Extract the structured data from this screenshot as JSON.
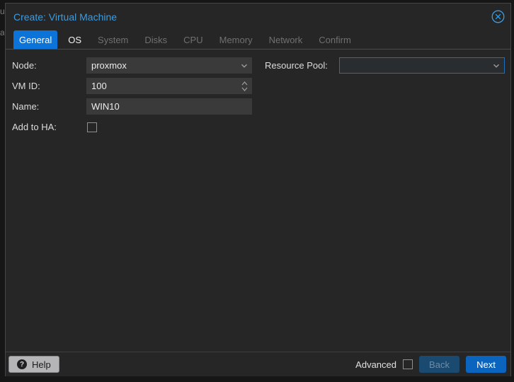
{
  "background": {
    "fragments": [
      "u",
      "al"
    ]
  },
  "dialog": {
    "title": "Create: Virtual Machine"
  },
  "tabs": [
    {
      "label": "General",
      "state": "active"
    },
    {
      "label": "OS",
      "state": "enabled"
    },
    {
      "label": "System",
      "state": "disabled"
    },
    {
      "label": "Disks",
      "state": "disabled"
    },
    {
      "label": "CPU",
      "state": "disabled"
    },
    {
      "label": "Memory",
      "state": "disabled"
    },
    {
      "label": "Network",
      "state": "disabled"
    },
    {
      "label": "Confirm",
      "state": "disabled"
    }
  ],
  "form": {
    "node": {
      "label": "Node:",
      "value": "proxmox",
      "type": "combobox"
    },
    "vmid": {
      "label": "VM ID:",
      "value": "100",
      "type": "spinner"
    },
    "name": {
      "label": "Name:",
      "value": "WIN10",
      "type": "text"
    },
    "ha": {
      "label": "Add to HA:",
      "checked": false,
      "type": "checkbox"
    },
    "pool": {
      "label": "Resource Pool:",
      "value": "",
      "type": "combobox",
      "focused": true
    }
  },
  "footer": {
    "help_label": "Help",
    "help_icon_glyph": "?",
    "advanced_label": "Advanced",
    "advanced_checked": false,
    "back_label": "Back",
    "next_label": "Next"
  },
  "colors": {
    "title_blue": "#3d9ce1",
    "active_tab_blue": "#0c74d8",
    "next_button_blue": "#0b64be",
    "back_button_blue": "#1b4a71",
    "focused_field_border": "#1f6fb8",
    "dialog_background": "#262626",
    "field_background": "#3a3a3a"
  }
}
